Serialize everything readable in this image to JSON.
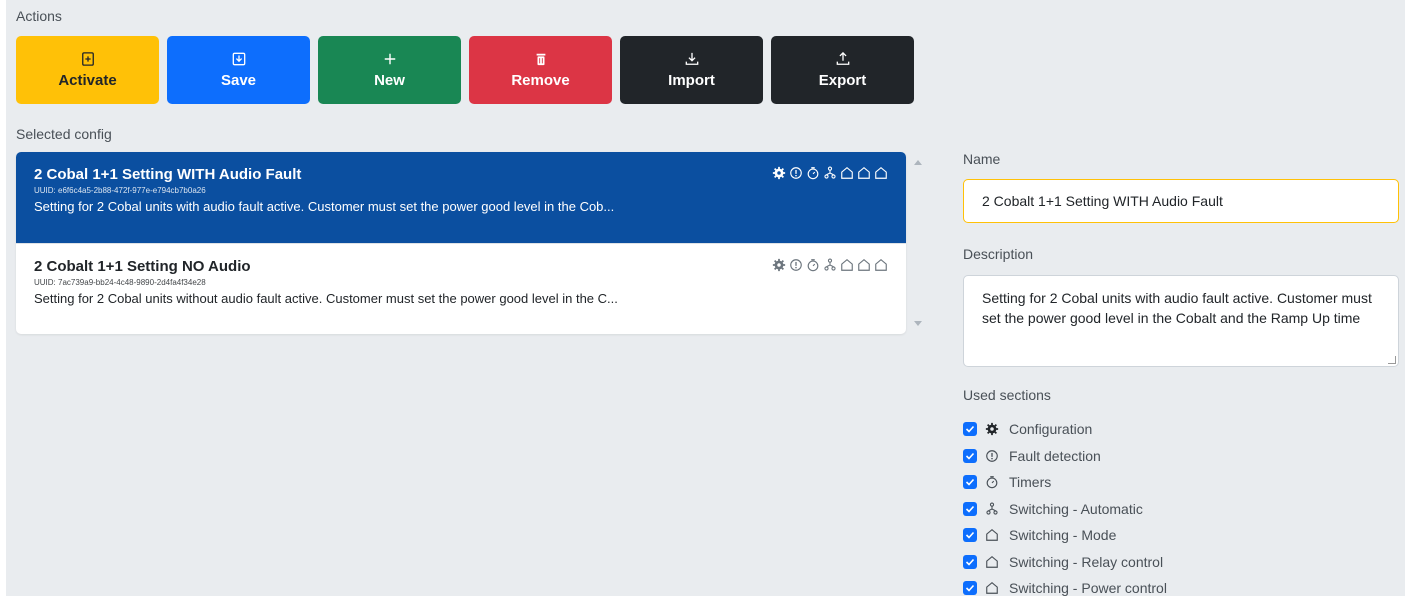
{
  "actions": {
    "label": "Actions",
    "buttons": [
      {
        "label": "Activate",
        "color": "#ffc107",
        "icon": "activate-icon"
      },
      {
        "label": "Save",
        "color": "#0d6efd",
        "icon": "save-icon"
      },
      {
        "label": "New",
        "color": "#198754",
        "icon": "plus-icon"
      },
      {
        "label": "Remove",
        "color": "#dc3545",
        "icon": "trash-icon"
      },
      {
        "label": "Import",
        "color": "#212529",
        "icon": "download-icon"
      },
      {
        "label": "Export",
        "color": "#212529",
        "icon": "upload-icon"
      }
    ]
  },
  "configs": {
    "label": "Selected config",
    "items": [
      {
        "title": "2 Cobal 1+1 Setting WITH Audio Fault",
        "uuid": "UUID: e6f6c4a5-2b88-472f-977e-e794cb7b0a26",
        "description": "Setting for 2 Cobal units with audio fault active. Customer must set the power good level in the Cob...",
        "active": true
      },
      {
        "title": "2 Cobalt 1+1 Setting NO Audio",
        "uuid": "UUID: 7ac739a9-bb24-4c48-9890-2d4fa4f34e28",
        "description": "Setting for 2 Cobal units without audio fault active. Customer must set the power good level in the C...",
        "active": false
      }
    ]
  },
  "details": {
    "name_label": "Name",
    "name_value": "2 Cobalt 1+1 Setting WITH Audio Fault",
    "description_label": "Description",
    "description_value": "Setting for 2 Cobal units with audio fault active. Customer must set the power good level in the Cobalt  and the Ramp Up time",
    "sections_label": "Used sections",
    "sections": [
      {
        "label": "Configuration",
        "icon": "gear-icon",
        "checked": true
      },
      {
        "label": "Fault detection",
        "icon": "fault-icon",
        "checked": true
      },
      {
        "label": "Timers",
        "icon": "timer-icon",
        "checked": true
      },
      {
        "label": "Switching - Automatic",
        "icon": "auto-switch-icon",
        "checked": true
      },
      {
        "label": "Switching - Mode",
        "icon": "switch-mode-icon",
        "checked": true
      },
      {
        "label": "Switching - Relay control",
        "icon": "relay-icon",
        "checked": true
      },
      {
        "label": "Switching - Power control",
        "icon": "power-icon",
        "checked": true
      }
    ]
  }
}
